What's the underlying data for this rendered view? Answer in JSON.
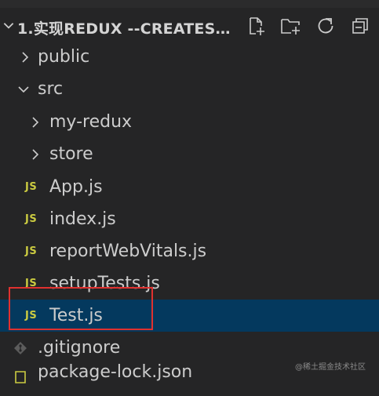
{
  "explorer": {
    "title": "1.实现REDUX --CREATESTO...",
    "actions": [
      {
        "icon": "new-file-icon"
      },
      {
        "icon": "new-folder-icon"
      },
      {
        "icon": "refresh-icon"
      },
      {
        "icon": "collapse-all-icon"
      }
    ]
  },
  "tree": {
    "public": "public",
    "src": "src",
    "my_redux": "my-redux",
    "store": "store",
    "app_js": "App.js",
    "index_js": "index.js",
    "report_web_vitals": "reportWebVitals.js",
    "setup_tests": "setupTests.js",
    "test_js": "Test.js",
    "gitignore": ".gitignore",
    "package_lock": "package-lock.json"
  },
  "badges": {
    "js": "JS"
  },
  "watermark": "@稀土掘金技术社区",
  "colors": {
    "background": "#252526",
    "selected_row": "#04395e",
    "js_badge": "#cbcb41",
    "highlight_box": "#e0312f"
  }
}
